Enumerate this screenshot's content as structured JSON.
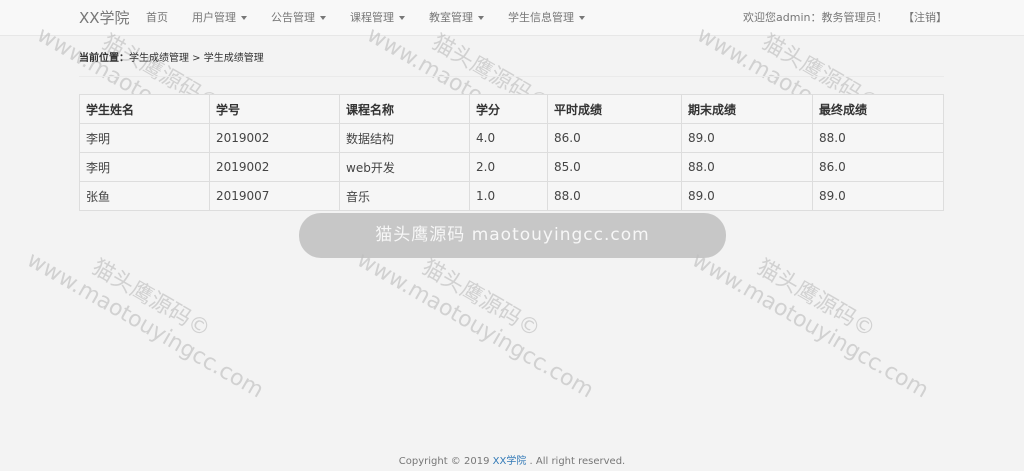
{
  "navbar": {
    "brand": "XX学院",
    "items": [
      {
        "label": "首页",
        "dropdown": false
      },
      {
        "label": "用户管理",
        "dropdown": true
      },
      {
        "label": "公告管理",
        "dropdown": true
      },
      {
        "label": "课程管理",
        "dropdown": true
      },
      {
        "label": "教室管理",
        "dropdown": true
      },
      {
        "label": "学生信息管理",
        "dropdown": true
      }
    ],
    "welcome": "欢迎您admin：教务管理员！",
    "logout": "【注销】"
  },
  "breadcrumb": {
    "label": "当前位置：",
    "path": "学生成绩管理 > 学生成绩管理"
  },
  "table": {
    "headers": [
      "学生姓名",
      "学号",
      "课程名称",
      "学分",
      "平时成绩",
      "期末成绩",
      "最终成绩"
    ],
    "rows": [
      [
        "李明",
        "2019002",
        "数据结构",
        "4.0",
        "86.0",
        "89.0",
        "88.0"
      ],
      [
        "李明",
        "2019002",
        "web开发",
        "2.0",
        "85.0",
        "88.0",
        "86.0"
      ],
      [
        "张鱼",
        "2019007",
        "音乐",
        "1.0",
        "88.0",
        "89.0",
        "89.0"
      ]
    ]
  },
  "toast": {
    "text": "猫头鹰源码 maotouyingcc.com"
  },
  "watermark": {
    "line1": "猫头鹰源码©",
    "line2": "www.maotouyingcc.com"
  },
  "footer": {
    "prefix": "Copyright © 2019 ",
    "link": "XX学院",
    "suffix": " . All right reserved."
  },
  "colors": {
    "background": "#f3f3f3",
    "navbar": "#f8f8f8",
    "link": "#337ab7"
  }
}
